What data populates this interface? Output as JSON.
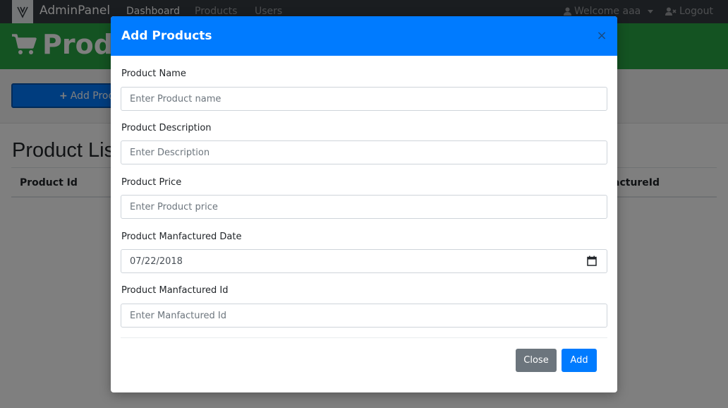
{
  "navbar": {
    "brand": "AdminPanel",
    "links": [
      {
        "label": "Dashboard",
        "active": true
      },
      {
        "label": "Products",
        "active": false
      },
      {
        "label": "Users",
        "active": false
      }
    ],
    "welcome": "Welcome aaa",
    "logout": "Logout"
  },
  "page": {
    "header_title": "Produ",
    "add_button_label": "Add Prod",
    "list_title": "Product Lis",
    "table_headers": [
      "Product Id",
      "actureId"
    ]
  },
  "modal": {
    "title": "Add Products",
    "close_icon": "×",
    "fields": {
      "name": {
        "label": "Product Name",
        "placeholder": "Enter Product name"
      },
      "description": {
        "label": "Product Description",
        "placeholder": "Enter Description"
      },
      "price": {
        "label": "Product Price",
        "placeholder": "Enter Product price"
      },
      "date": {
        "label": "Product Manfactured Date",
        "value": "07/22/2018"
      },
      "manufacturer_id": {
        "label": "Product Manfactured Id",
        "placeholder": "Enter Manfactured Id"
      }
    },
    "buttons": {
      "close": "Close",
      "add": "Add"
    }
  },
  "colors": {
    "navbar": "#343a40",
    "header_green": "#28a745",
    "primary": "#007bff",
    "secondary": "#6c757d"
  }
}
